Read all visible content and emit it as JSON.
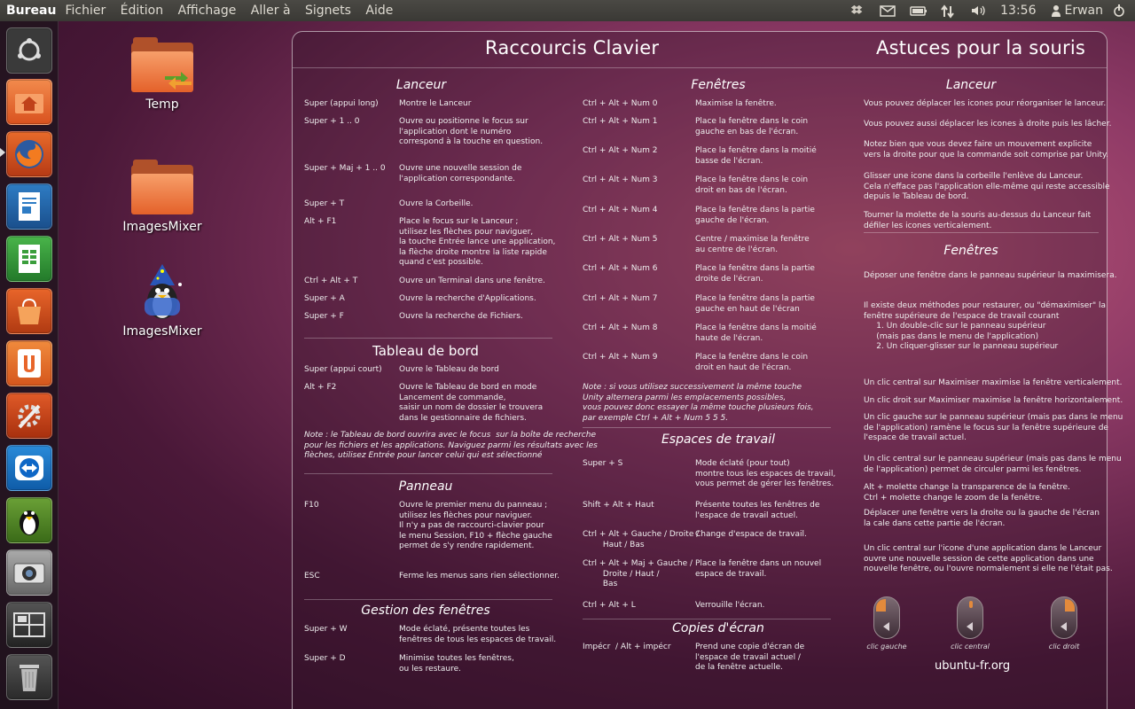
{
  "topbar": {
    "title": "Bureau",
    "menus": [
      "Fichier",
      "Édition",
      "Affichage",
      "Aller à",
      "Signets",
      "Aide"
    ],
    "time": "13:56",
    "user": "Erwan"
  },
  "desktop": {
    "icons": [
      {
        "label": "Temp"
      },
      {
        "label": "ImagesMixer"
      },
      {
        "label": "ImagesMixer"
      }
    ]
  },
  "launcher": {
    "items": [
      "ubuntu-home",
      "home-folder",
      "firefox",
      "writer",
      "calc",
      "software-center",
      "ubuntu-one",
      "system-settings",
      "teamviewer",
      "ubuntu-tweak",
      "cheese",
      "workspaces",
      "trash"
    ]
  },
  "panel": {
    "title_left": "Raccourcis Clavier",
    "title_right": "Astuces pour la souris",
    "lanceur_h": "Lanceur",
    "tableau_h": "Tableau de bord",
    "panneau_h": "Panneau",
    "gestion_h": "Gestion des fenêtres",
    "fenetres_h": "Fenêtres",
    "espaces_h": "Espaces de travail",
    "copies_h": "Copies d'écran",
    "mouse_lanceur_h": "Lanceur",
    "mouse_fenetres_h": "Fenêtres",
    "lanceur": [
      {
        "k": "Super (appui long)",
        "d": "Montre le Lanceur"
      },
      {
        "k": "Super + 1 .. 0",
        "d": "Ouvre ou positionne le focus sur\nl'application dont le numéro\ncorrespond à la touche en question."
      },
      {
        "k": "Super + Maj + 1 .. 0",
        "d": "Ouvre une nouvelle session de\nl'application correspondante."
      },
      {
        "k": "Super + T",
        "d": "Ouvre la Corbeille."
      },
      {
        "k": "Alt + F1",
        "d": "Place le focus sur le Lanceur ;\nutilisez les flèches pour naviguer,\nla touche Entrée lance une application,\nla flèche droite montre la liste rapide\nquand c'est possible."
      },
      {
        "k": "Ctrl + Alt + T",
        "d": "Ouvre un Terminal dans une fenêtre."
      },
      {
        "k": "Super + A",
        "d": "Ouvre la recherche d'Applications."
      },
      {
        "k": "Super + F",
        "d": "Ouvre la recherche de Fichiers."
      }
    ],
    "tableau": [
      {
        "k": "Super (appui court)",
        "d": "Ouvre le Tableau de bord"
      },
      {
        "k": "Alt + F2",
        "d": "Ouvre le Tableau de bord en mode\nLancement de commande,\nsaisir un nom de dossier le trouvera\ndans le gestionnaire de fichiers."
      }
    ],
    "tableau_note": "Note : le Tableau de bord ouvrira avec le focus  sur la boîte de recherche\npour les fichiers et les applications. Naviguez parmi les résultats avec les\nflèches, utilisez Entrée pour lancer celui qui est sélectionné",
    "panneau": [
      {
        "k": "F10",
        "d": "Ouvre le premier menu du panneau ;\nutilisez les flèches pour naviguer.\nIl n'y a pas de raccourci-clavier pour\nle menu Session, F10 + flèche gauche\npermet de s'y rendre rapidement."
      },
      {
        "k": "ESC",
        "d": "Ferme les menus sans rien sélectionner."
      }
    ],
    "gestion": [
      {
        "k": "Super + W",
        "d": "Mode éclaté, présente toutes les\nfenêtres de tous les espaces de travail."
      },
      {
        "k": "Super + D",
        "d": "Minimise toutes les fenêtres,\nou les restaure."
      }
    ],
    "fenetres": [
      {
        "k": "Ctrl + Alt + Num 0",
        "d": "Maximise la fenêtre."
      },
      {
        "k": "Ctrl + Alt + Num 1",
        "d": "Place la fenêtre dans le coin\ngauche en bas de l'écran."
      },
      {
        "k": "Ctrl + Alt + Num 2",
        "d": "Place la fenêtre dans la moitié\nbasse de l'écran."
      },
      {
        "k": "Ctrl + Alt + Num 3",
        "d": "Place la fenêtre dans le coin\ndroit en bas de l'écran."
      },
      {
        "k": "Ctrl + Alt + Num 4",
        "d": "Place la fenêtre dans la partie\ngauche de l'écran."
      },
      {
        "k": "Ctrl + Alt + Num 5",
        "d": "Centre / maximise la fenêtre\nau centre de l'écran."
      },
      {
        "k": "Ctrl + Alt + Num 6",
        "d": "Place la fenêtre dans la partie\ndroite de l'écran."
      },
      {
        "k": "Ctrl + Alt + Num 7",
        "d": "Place la fenêtre dans la partie\ngauche en haut de l'écran"
      },
      {
        "k": "Ctrl + Alt + Num 8",
        "d": "Place la fenêtre dans la moitié\nhaute de l'écran."
      },
      {
        "k": "Ctrl + Alt + Num 9",
        "d": "Place la fenêtre dans le coin\ndroit en haut de l'écran."
      }
    ],
    "fenetres_note": "Note : si vous utilisez successivement la même touche\nUnity alternera parmi les emplacements possibles,\nvous pouvez donc essayer la même touche plusieurs fois,\npar exemple Ctrl + Alt + Num 5 5 5.",
    "espaces": [
      {
        "k": "Super + S",
        "d": "Mode éclaté (pour tout)\nmontre tous les espaces de travail,\nvous permet de gérer les fenêtres."
      },
      {
        "k": "Shift + Alt + Haut",
        "d": "Présente toutes les fenêtres de\nl'espace de travail actuel."
      },
      {
        "k": "Ctrl + Alt + Gauche / Droite /\n        Haut / Bas",
        "d": "Change d'espace de travail."
      },
      {
        "k": "Ctrl + Alt + Maj + Gauche /\n        Droite / Haut /\n        Bas",
        "d": "Place la fenêtre dans un nouvel\nespace de travail."
      },
      {
        "k": "Ctrl + Alt + L",
        "d": "Verrouille l'écran."
      }
    ],
    "copies": [
      {
        "k": "Impécr  / Alt + impécr",
        "d": "Prend une copie d'écran de\nl'espace de travail actuel /\nde la fenêtre actuelle."
      }
    ],
    "mouse_lanceur": [
      "Vous pouvez déplacer les icones pour réorganiser le lanceur.",
      "Vous pouvez aussi déplacer les icones à droite puis les lâcher.",
      "Notez bien que vous devez faire un mouvement explicite\nvers la droite pour que la commande soit comprise par Unity.",
      "Glisser une icone dans la corbeille l'enlève du Lanceur.\nCela n'efface pas l'application elle-même qui reste accessible\ndepuis le Tableau de bord.",
      "Tourner la molette de la souris au-dessus du Lanceur fait\ndéfiler les icones verticalement."
    ],
    "mouse_fenetres": [
      "Déposer une fenêtre dans le panneau supérieur la maximisera.",
      "Il existe deux méthodes pour restaurer, ou \"démaximiser\" la\nfenêtre supérieure de l'espace de travail courant\n     1. Un double-clic sur le panneau supérieur\n     (mais pas dans le menu de l'application)\n     2. Un cliquer-glisser sur le panneau supérieur",
      "Un clic central sur Maximiser maximise la fenêtre verticalement.",
      "Un clic droit sur Maximiser maximise la fenêtre horizontalement.",
      "Un clic gauche sur le panneau supérieur (mais pas dans le menu\nde l'application) ramène le focus sur la fenêtre supérieure de\nl'espace de travail actuel.",
      "Un clic central sur le panneau supérieur (mais pas dans le menu\nde l'application) permet de circuler parmi les fenêtres.",
      "Alt + molette change la transparence de la fenêtre.\nCtrl + molette change le zoom de la fenêtre.",
      "Déplacer une fenêtre vers la droite ou la gauche de l'écran\nla cale dans cette partie de l'écran.",
      "Un clic central sur l'icone d'une application dans le Lanceur\nouvre une nouvelle session de cette application dans une\nnouvelle fenêtre, ou l'ouvre normalement si elle ne l'était pas."
    ],
    "mouse_labels": [
      "clic gauche",
      "clic central",
      "clic droit"
    ],
    "site": "ubuntu-fr.org"
  }
}
